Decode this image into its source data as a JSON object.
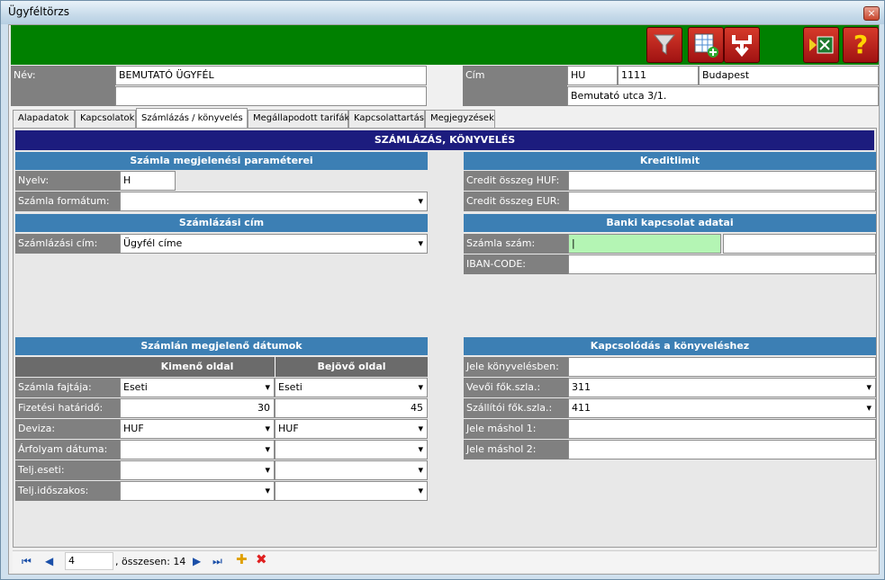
{
  "window": {
    "title": "Ügyféltörzs",
    "close_label": "×"
  },
  "toolbar": {
    "buttons": [
      {
        "name": "filter-button",
        "icon": "filter-icon"
      },
      {
        "name": "new-record-button",
        "icon": "grid-plus-icon"
      },
      {
        "name": "select-button",
        "icon": "fork-down-icon"
      },
      {
        "name": "export-excel-button",
        "icon": "excel-export-icon"
      },
      {
        "name": "help-button",
        "icon": "help-icon",
        "glyph": "?"
      }
    ]
  },
  "customer": {
    "name_label": "Név:",
    "name_value": "BEMUTATÓ ÜGYFÉL",
    "name_value2": "",
    "address_label": "Cím",
    "country": "HU",
    "zip": "1111",
    "city": "Budapest",
    "street": "Bemutató utca 3/1."
  },
  "tabs": [
    "Alapadatok",
    "Kapcsolatok",
    "Számlázás / könyvelés",
    "Megállapodott tarifák",
    "Kapcsolattartás",
    "Megjegyzések"
  ],
  "banner": "SZÁMLÁZÁS, KÖNYVELÉS",
  "invoice_params": {
    "header": "Számla megjelenési paraméterei",
    "language_label": "Nyelv:",
    "language_value": "H",
    "format_label": "Számla formátum:",
    "format_value": ""
  },
  "billing_address": {
    "header": "Számlázási cím",
    "label": "Számlázási cím:",
    "value": "Ügyfél címe"
  },
  "credit": {
    "header": "Kreditlimit",
    "huf_label": "Credit összeg HUF:",
    "huf_value": "",
    "eur_label": "Credit összeg EUR:",
    "eur_value": ""
  },
  "bank": {
    "header": "Banki kapcsolat adatai",
    "account_label": "Számla szám:",
    "account_value": "|",
    "account_value2": "",
    "iban_label": "IBAN-CODE:",
    "iban_value": ""
  },
  "dates": {
    "header": "Számlán megjelenő dátumok",
    "col_out": "Kimenő oldal",
    "col_in": "Bejövő oldal",
    "rows": [
      {
        "label": "Számla fajtája:",
        "out": "Eseti",
        "in": "Eseti"
      },
      {
        "label": "Fizetési határidő:",
        "out": "30",
        "in": "45"
      },
      {
        "label": "Deviza:",
        "out": "HUF",
        "in": "HUF"
      },
      {
        "label": "Árfolyam dátuma:",
        "out": "",
        "in": ""
      },
      {
        "label": "Telj.eseti:",
        "out": "",
        "in": ""
      },
      {
        "label": "Telj.időszakos:",
        "out": "",
        "in": ""
      }
    ]
  },
  "accounting": {
    "header": "Kapcsolódás a könyveléshez",
    "rows": [
      {
        "label": "Jele könyvelésben:",
        "value": ""
      },
      {
        "label": "Vevői fők.szla.:",
        "value": "311"
      },
      {
        "label": "Szállítói fők.szla.:",
        "value": "411"
      },
      {
        "label": "Jele máshol 1:",
        "value": ""
      },
      {
        "label": "Jele máshol 2:",
        "value": ""
      }
    ]
  },
  "nav": {
    "current": "4",
    "total_text": ", összesen: 14"
  },
  "colors": {
    "green": "#008000",
    "section_blue": "#3c7fb4",
    "banner_navy": "#1c1c7e",
    "highlight": "#b4f5b4"
  }
}
